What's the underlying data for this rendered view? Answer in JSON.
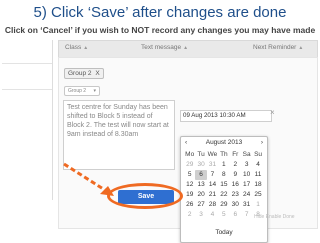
{
  "slide": {
    "title": "5) Click ‘Save’ after changes are done",
    "subtitle": "Click on ‘Cancel’ if you wish to NOT record any changes you may have made"
  },
  "table_header": {
    "columns": [
      "Class",
      "Text message",
      "Next Reminder"
    ]
  },
  "form": {
    "group_tag": "Group 2",
    "group_tag_remove": "X",
    "dropdown_value": "Group 2",
    "notes_text": "Test centre for Sunday has been shifted to Block 5 instead of Block 2. The test will now start at 9am instead of 8.30am",
    "date_value": "09 Aug 2013 10:30 AM",
    "date_clear": "×",
    "save_label": "Save"
  },
  "calendar": {
    "month_label": "August 2013",
    "prev_icon": "‹",
    "next_icon": "›",
    "weekdays": [
      "Mo",
      "Tu",
      "We",
      "Th",
      "Fr",
      "Sa",
      "Su"
    ],
    "weeks": [
      [
        "29",
        "30",
        "31",
        "1",
        "2",
        "3",
        "4"
      ],
      [
        "5",
        "6",
        "7",
        "8",
        "9",
        "10",
        "11"
      ],
      [
        "12",
        "13",
        "14",
        "15",
        "16",
        "17",
        "18"
      ],
      [
        "19",
        "20",
        "21",
        "22",
        "23",
        "24",
        "25"
      ],
      [
        "26",
        "27",
        "28",
        "29",
        "30",
        "31",
        "1"
      ],
      [
        "2",
        "3",
        "4",
        "5",
        "6",
        "7",
        "8"
      ]
    ],
    "selected": "6",
    "today_label": "Today"
  },
  "footer": {
    "links": "Hide  Enable  Done"
  },
  "colors": {
    "title": "#1f4f8a",
    "save_button": "#2f6fd1",
    "highlight": "#ef6a22"
  }
}
